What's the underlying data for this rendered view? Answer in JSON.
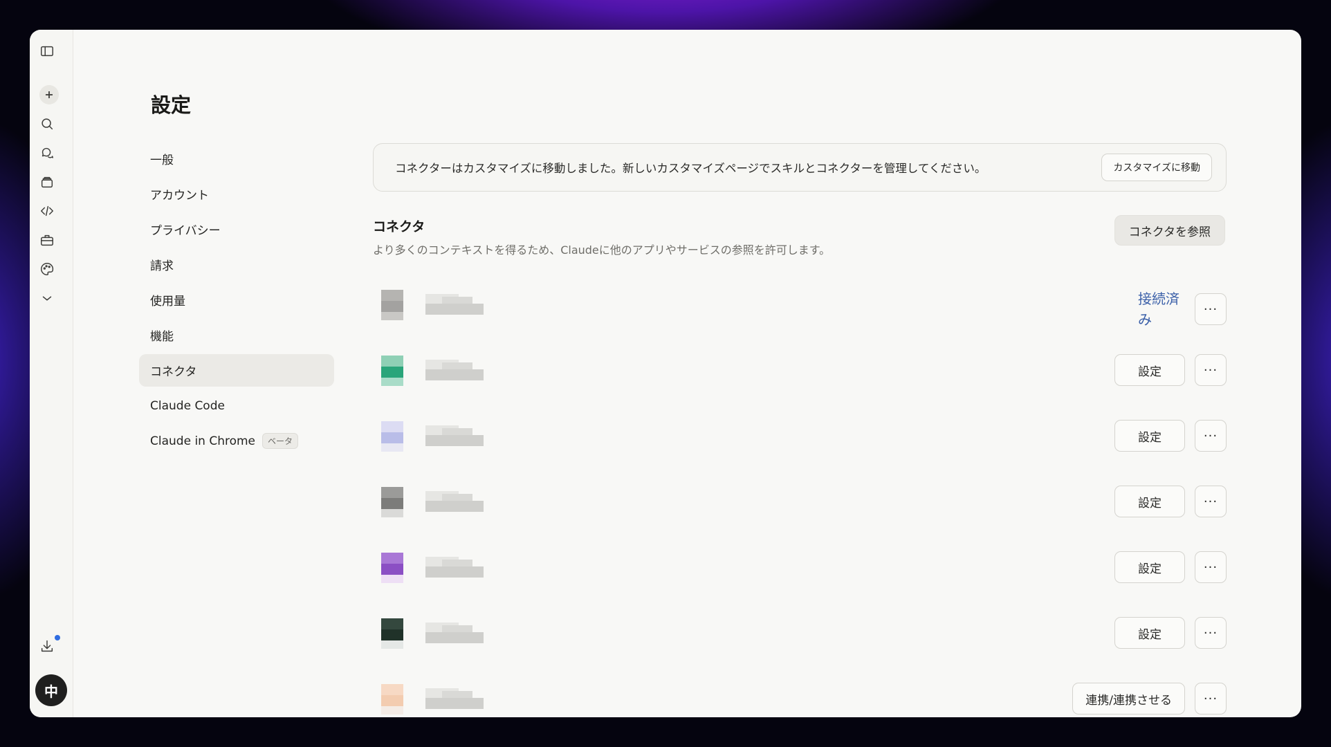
{
  "rail": {
    "icons": [
      "sidebar-toggle-icon",
      "plus-icon",
      "search-icon",
      "chats-icon",
      "projects-icon",
      "code-icon",
      "toolbox-icon",
      "palette-icon",
      "chevron-down-icon",
      "download-icon"
    ],
    "avatar_initial": "中"
  },
  "page_title": "設定",
  "nav": {
    "items": [
      {
        "label": "一般"
      },
      {
        "label": "アカウント"
      },
      {
        "label": "プライバシー"
      },
      {
        "label": "請求"
      },
      {
        "label": "使用量"
      },
      {
        "label": "機能"
      },
      {
        "label": "コネクタ"
      },
      {
        "label": "Claude Code"
      },
      {
        "label": "Claude in Chrome",
        "badge": "ベータ"
      }
    ],
    "active_index": 6
  },
  "banner": {
    "text": "コネクターはカスタマイズに移動しました。新しいカスタマイズページでスキルとコネクターを管理してください。",
    "button": "カスタマイズに移動"
  },
  "section": {
    "title": "コネクタ",
    "description": "より多くのコンテキストを得るため、Claudeに他のアプリやサービスの参照を許可します。",
    "browse_button": "コネクタを参照"
  },
  "connectors": [
    {
      "status": "接続済み",
      "more": "···",
      "colors": [
        "#b5b4b1",
        "#a3a2a0",
        "#c9c8c5"
      ]
    },
    {
      "action": "設定",
      "more": "···",
      "colors": [
        "#8fd0b5",
        "#2aa57a",
        "#a9dcc8"
      ]
    },
    {
      "action": "設定",
      "more": "···",
      "colors": [
        "#dcdcf3",
        "#b9bde8",
        "#e8e8f3"
      ]
    },
    {
      "action": "設定",
      "more": "···",
      "colors": [
        "#9b9b99",
        "#7c7c7a",
        "#dadad8"
      ]
    },
    {
      "action": "設定",
      "more": "···",
      "colors": [
        "#a978d6",
        "#8b4fc4",
        "#eedff5"
      ]
    },
    {
      "action": "設定",
      "more": "···",
      "colors": [
        "#34483e",
        "#203229",
        "#e5e8e6"
      ]
    },
    {
      "action": "連携/連携させる",
      "more": "···",
      "colors": [
        "#f7d9c4",
        "#f3ccb0",
        "#f4ece6"
      ]
    }
  ],
  "colors": {
    "window_bg": "#f8f8f6",
    "accent_link": "#3a5fa8",
    "notification_dot": "#2f6ce0"
  }
}
